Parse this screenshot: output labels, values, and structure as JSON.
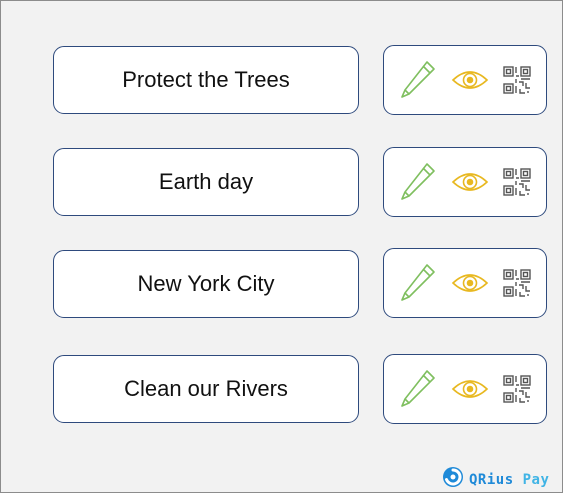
{
  "campaigns": [
    {
      "name": "Protect the Trees"
    },
    {
      "name": "Earth day"
    },
    {
      "name": "New York City"
    },
    {
      "name": "Clean our Rivers"
    }
  ],
  "brand": {
    "name_part1": "QRius",
    "name_part2": "Pay",
    "color_primary": "#1f8ad8",
    "color_secondary": "#40b4e5"
  },
  "icons": [
    "edit-pencil-icon",
    "view-eye-icon",
    "qr-code-icon"
  ],
  "colors": {
    "border": "#2e4a7d",
    "pencil": "#7fbf5f",
    "eye": "#e8b820",
    "qr": "#555555"
  }
}
